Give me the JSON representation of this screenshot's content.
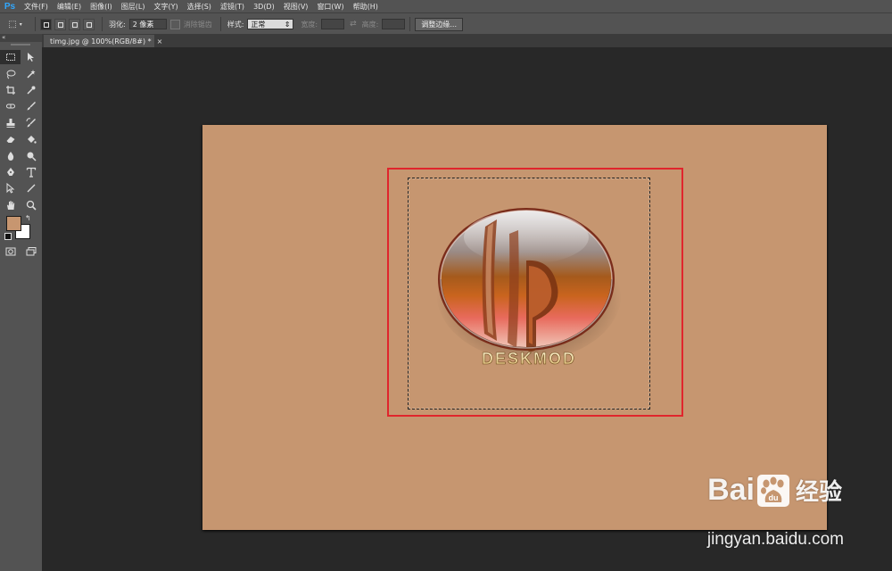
{
  "app": {
    "logo": "Ps"
  },
  "menu": [
    "文件(F)",
    "编辑(E)",
    "图像(I)",
    "图层(L)",
    "文字(Y)",
    "选择(S)",
    "滤镜(T)",
    "3D(D)",
    "视图(V)",
    "窗口(W)",
    "帮助(H)"
  ],
  "options": {
    "tool_icon": "rect-marquee-icon",
    "feather_label": "羽化:",
    "feather_value": "2 像素",
    "antialias_label": "消除锯齿",
    "style_label": "样式:",
    "style_value": "正常",
    "width_label": "宽度:",
    "height_label": "高度:",
    "refine_edge_button": "调整边缘..."
  },
  "document": {
    "tab_title": "timg.jpg @ 100%(RGB/8#) *",
    "close": "×"
  },
  "colors": {
    "foreground": "#c79670",
    "background": "#ffffff",
    "canvas": "#c69670",
    "highlight": "#e0252c"
  },
  "logo_text": "DESKMOD",
  "watermark": {
    "brand_left": "Bai",
    "brand_right": "经验",
    "url": "jingyan.baidu.com"
  }
}
